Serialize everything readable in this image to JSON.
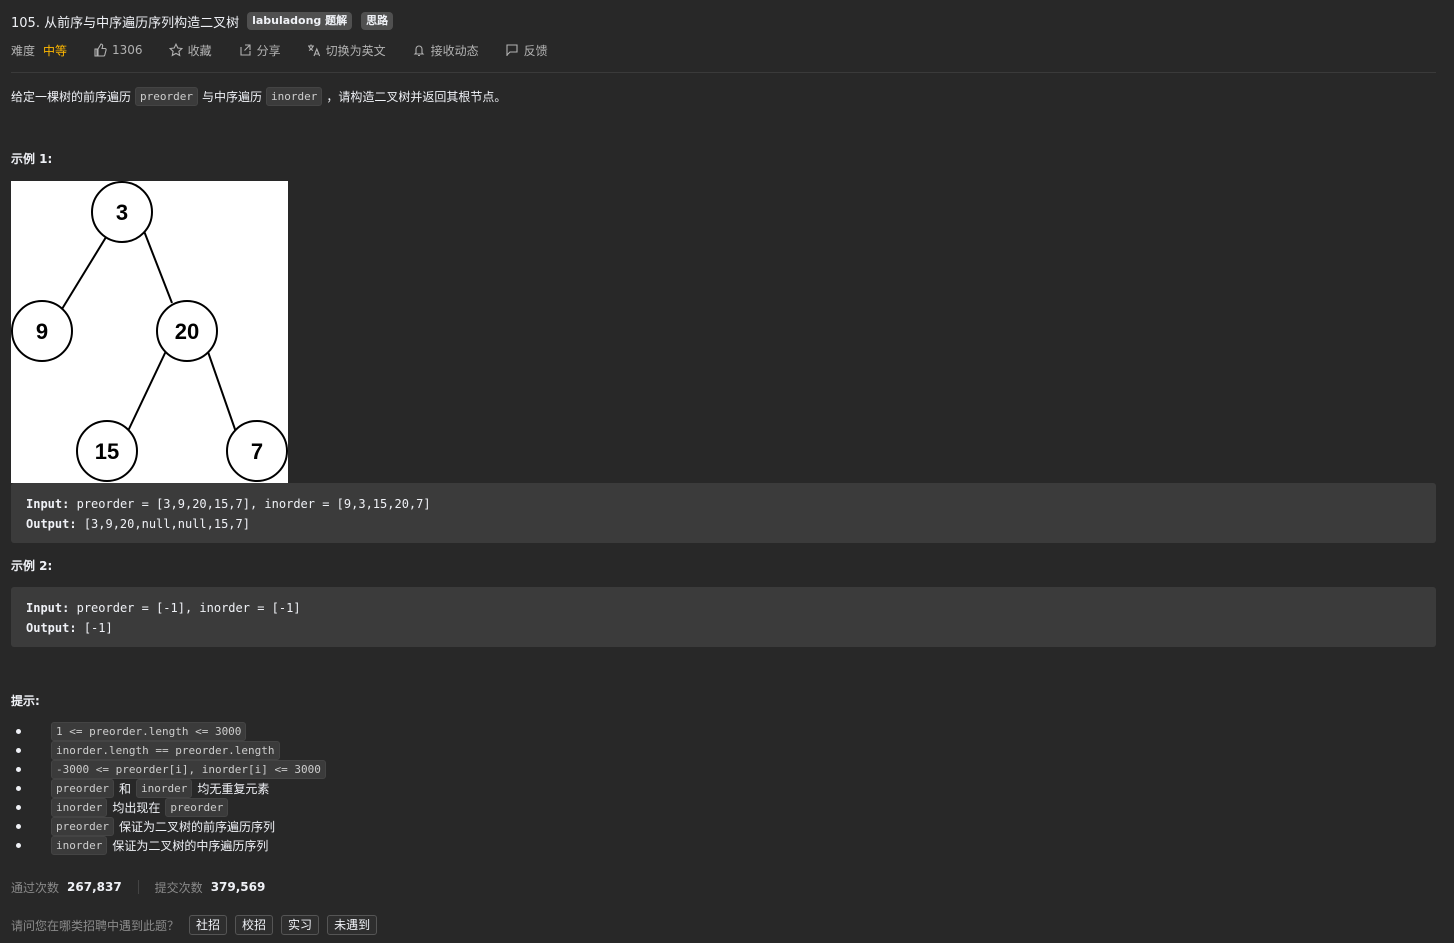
{
  "problem": {
    "title": "105. 从前序与中序遍历序列构造二叉树",
    "tags": [
      "labuladong 题解",
      "思路"
    ]
  },
  "meta": {
    "difficulty_label": "难度",
    "difficulty": "中等",
    "likes": "1306",
    "favorite": "收藏",
    "share": "分享",
    "switch_lang": "切换为英文",
    "subscribe": "接收动态",
    "feedback": "反馈"
  },
  "description": {
    "part1": "给定一棵树的前序遍历",
    "code1": "preorder",
    "part2": "与中序遍历",
    "code2": "inorder",
    "part3": "，请构造二叉树并返回其根节点。"
  },
  "example1": {
    "title": "示例 1:",
    "tree_nodes": [
      "3",
      "9",
      "20",
      "15",
      "7"
    ],
    "input_label": "Input:",
    "input": "preorder = [3,9,20,15,7], inorder = [9,3,15,20,7]",
    "output_label": "Output:",
    "output": "[3,9,20,null,null,15,7]"
  },
  "example2": {
    "title": "示例 2:",
    "input_label": "Input:",
    "input": "preorder = [-1], inorder = [-1]",
    "output_label": "Output:",
    "output": "[-1]"
  },
  "hints": {
    "title": "提示:",
    "items": [
      {
        "code": "1 <= preorder.length <= 3000"
      },
      {
        "code": "inorder.length == preorder.length"
      },
      {
        "code": "-3000 <= preorder[i], inorder[i] <= 3000"
      },
      {
        "code": "preorder",
        "text": "和",
        "code2": "inorder",
        "text2": "均无重复元素"
      },
      {
        "code": "inorder",
        "text": "均出现在",
        "code2": "preorder"
      },
      {
        "code": "preorder",
        "text": "保证为二叉树的前序遍历序列"
      },
      {
        "code": "inorder",
        "text": "保证为二叉树的中序遍历序列"
      }
    ]
  },
  "stats": {
    "accepted_label": "通过次数",
    "accepted": "267,837",
    "submissions_label": "提交次数",
    "submissions": "379,569"
  },
  "survey": {
    "question": "请问您在哪类招聘中遇到此题？",
    "options": [
      "社招",
      "校招",
      "实习",
      "未遇到"
    ]
  },
  "colors": {
    "background": "#282828",
    "difficulty": "#ffb800",
    "code_bg": "#3b3b3b"
  }
}
